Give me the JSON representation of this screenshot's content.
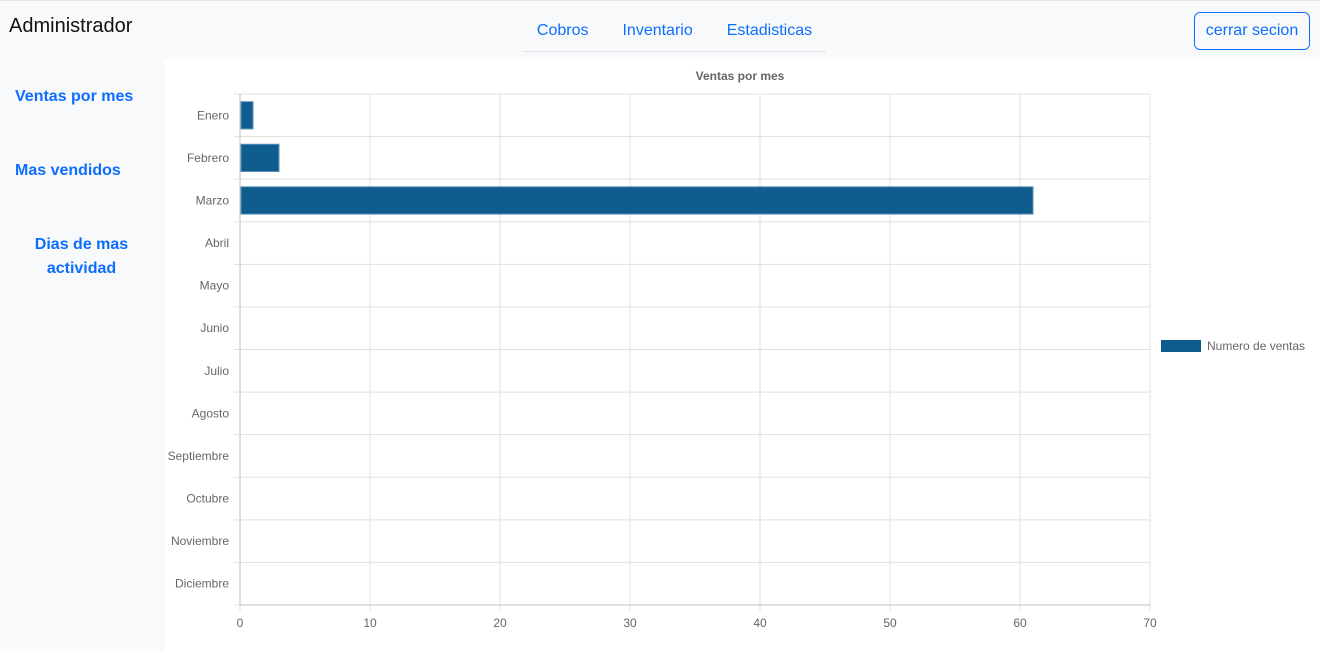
{
  "header": {
    "brand": "Administrador",
    "nav": [
      {
        "label": "Cobros"
      },
      {
        "label": "Inventario"
      },
      {
        "label": "Estadisticas"
      }
    ],
    "logout_label": "cerrar secion"
  },
  "sidebar": {
    "items": [
      {
        "label": "Ventas por mes"
      },
      {
        "label": "Mas vendidos"
      },
      {
        "label": "Dias de mas actividad"
      }
    ]
  },
  "colors": {
    "accent": "#0d6efd",
    "bar": "#0f5c8e",
    "grid": "#e0e0e0"
  },
  "chart_data": {
    "type": "bar",
    "orientation": "horizontal",
    "title": "Ventas por mes",
    "categories": [
      "Enero",
      "Febrero",
      "Marzo",
      "Abril",
      "Mayo",
      "Junio",
      "Julio",
      "Agosto",
      "Septiembre",
      "Octubre",
      "Noviembre",
      "Diciembre"
    ],
    "series": [
      {
        "name": "Numero de ventas",
        "values": [
          1,
          3,
          61,
          0,
          0,
          0,
          0,
          0,
          0,
          0,
          0,
          0
        ]
      }
    ],
    "xlim": [
      0,
      70
    ],
    "xticks": [
      0,
      10,
      20,
      30,
      40,
      50,
      60,
      70
    ],
    "grid": true,
    "legend": "right"
  }
}
